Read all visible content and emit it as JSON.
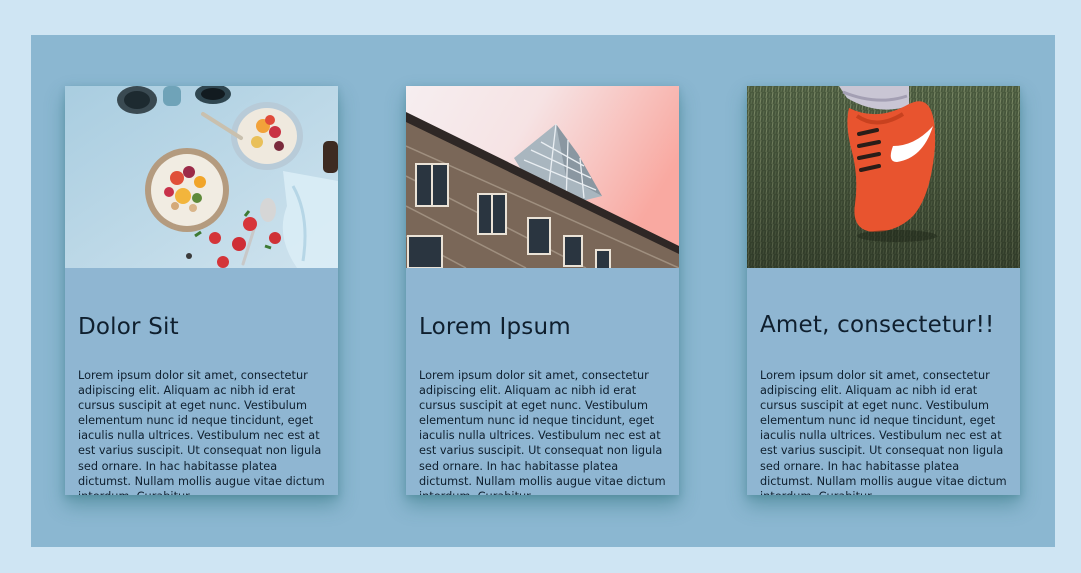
{
  "cards": [
    {
      "title": "Dolor Sit",
      "text": "Lorem ipsum dolor sit amet, consectetur adipiscing elit. Aliquam ac nibh id erat cursus suscipit at eget nunc. Vestibulum elementum nunc id neque tincidunt, eget iaculis nulla ultrices. Vestibulum nec est at est varius suscipit. Ut consequat non ligula sed ornare. In hac habitasse platea dictumst. Nullam mollis augue vitae dictum interdum. Curabitur",
      "image": "breakfast-bowls-photo"
    },
    {
      "title": "Lorem Ipsum",
      "text": "Lorem ipsum dolor sit amet, consectetur adipiscing elit. Aliquam ac nibh id erat cursus suscipit at eget nunc. Vestibulum elementum nunc id neque tincidunt, eget iaculis nulla ultrices. Vestibulum nec est at est varius suscipit. Ut consequat non ligula sed ornare. In hac habitasse platea dictumst. Nullam mollis augue vitae dictum interdum. Curabitur",
      "image": "building-architecture-photo"
    },
    {
      "title": "Amet, consectetur!!",
      "text": "Lorem ipsum dolor sit amet, consectetur adipiscing elit. Aliquam ac nibh id erat cursus suscipit at eget nunc. Vestibulum elementum nunc id neque tincidunt, eget iaculis nulla ultrices. Vestibulum nec est at est varius suscipit. Ut consequat non ligula sed ornare. In hac habitasse platea dictumst. Nullam mollis augue vitae dictum interdum. Curabitur",
      "image": "red-football-boot-photo"
    }
  ],
  "colors": {
    "page_background": "#cfe5f3",
    "panel_background": "#8bb7d1",
    "card_background": "#8fb6d2",
    "text": "#0f1f2e"
  }
}
